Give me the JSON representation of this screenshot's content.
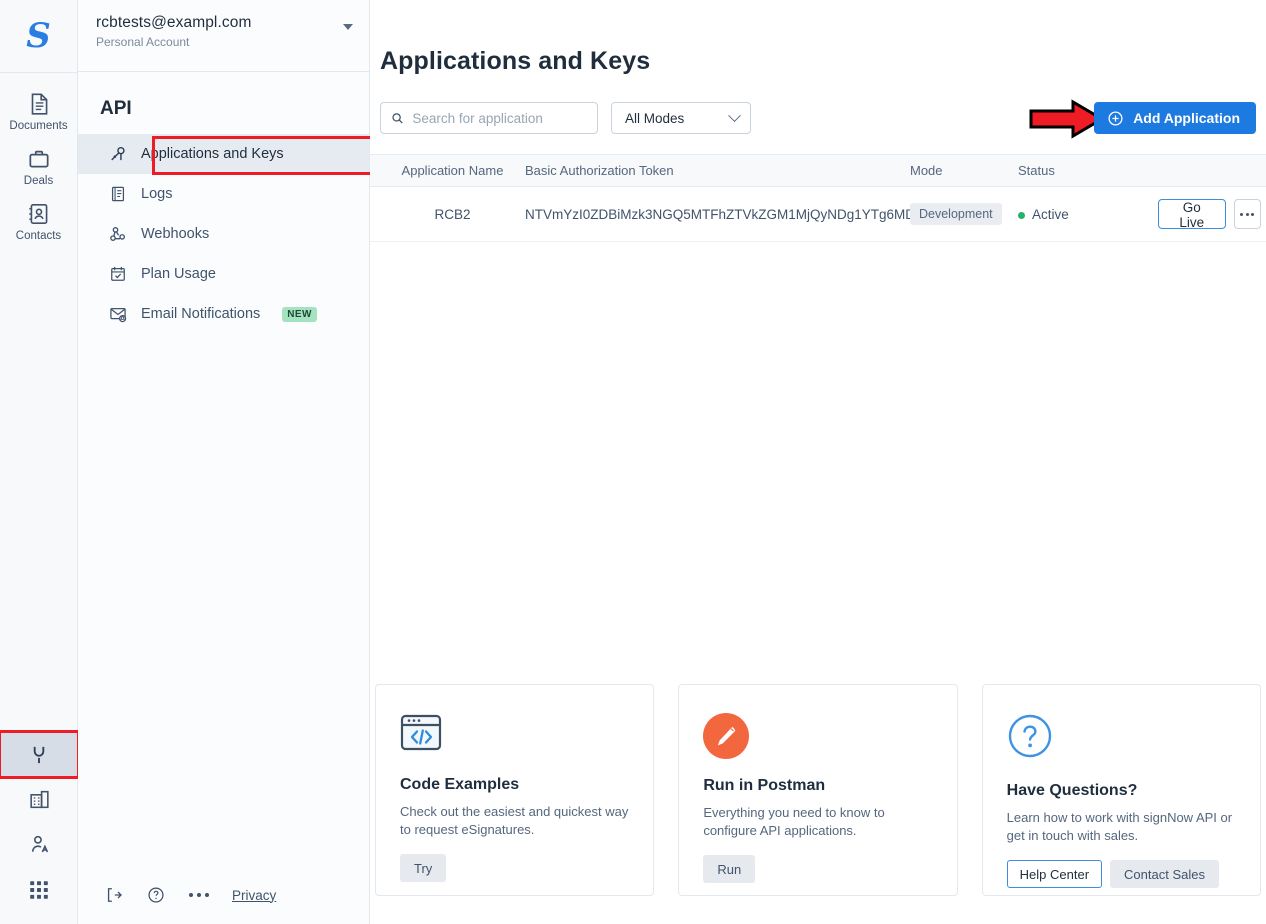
{
  "brand": {
    "logo_glyph": "S",
    "logo_color": "#2a7de1"
  },
  "account": {
    "email": "rcbtests@exampl.com",
    "type": "Personal Account"
  },
  "rail": {
    "items": [
      {
        "label": "Documents",
        "icon": "documents-icon"
      },
      {
        "label": "Deals",
        "icon": "briefcase-icon"
      },
      {
        "label": "Contacts",
        "icon": "contacts-icon"
      }
    ],
    "bottom_items": [
      {
        "icon": "plug-icon",
        "selected": true
      },
      {
        "icon": "building-icon",
        "selected": false
      },
      {
        "icon": "user-admin-icon",
        "selected": false
      },
      {
        "icon": "apps-grid-icon",
        "selected": false
      }
    ]
  },
  "sidebar": {
    "title": "API",
    "items": [
      {
        "label": "Applications and Keys",
        "icon": "key-icon",
        "active": true,
        "badge": ""
      },
      {
        "label": "Logs",
        "icon": "logs-icon",
        "active": false,
        "badge": ""
      },
      {
        "label": "Webhooks",
        "icon": "webhook-icon",
        "active": false,
        "badge": ""
      },
      {
        "label": "Plan Usage",
        "icon": "calendar-check-icon",
        "active": false,
        "badge": ""
      },
      {
        "label": "Email Notifications",
        "icon": "email-bell-icon",
        "active": false,
        "badge": "NEW"
      }
    ],
    "footer": {
      "logout_icon": "logout-icon",
      "help_icon": "help-circle-icon",
      "more_icon": "more-dots-icon",
      "privacy_label": "Privacy"
    }
  },
  "main": {
    "page_title": "Applications and Keys",
    "search": {
      "placeholder": "Search for application",
      "value": "",
      "icon": "search-icon"
    },
    "mode_filter": {
      "selected": "All Modes",
      "icon": "chevron-down-icon"
    },
    "add_button": {
      "label": "Add Application",
      "icon": "plus-circle-icon",
      "color": "#1d7ae0"
    },
    "annotation": {
      "type": "red-arrow",
      "points_to": "Add Application",
      "color": "#ee1c25"
    },
    "table": {
      "columns": [
        "Application Name",
        "Basic Authorization Token",
        "Mode",
        "Status",
        ""
      ],
      "rows": [
        {
          "name": "RCB2",
          "token": "NTVmYzI0ZDBiMzk3NGQ5MTFhZTVkZGM1MjQyNDg1YTg6MD...",
          "mode": "Development",
          "status": "Active",
          "status_color": "#23b26d",
          "action_primary": "Go Live",
          "action_more": "•••"
        }
      ]
    },
    "cards": [
      {
        "icon": "code-window-icon",
        "title": "Code Examples",
        "desc": "Check out the easiest and quickest way to request eSignatures.",
        "buttons": [
          {
            "label": "Try",
            "style": "gray"
          }
        ]
      },
      {
        "icon": "postman-pen-icon",
        "title": "Run in Postman",
        "desc": "Everything you need to know to configure API applications.",
        "buttons": [
          {
            "label": "Run",
            "style": "gray"
          }
        ]
      },
      {
        "icon": "question-circle-icon",
        "title": "Have Questions?",
        "desc": "Learn how to work with signNow API or get in touch with sales.",
        "buttons": [
          {
            "label": "Help Center",
            "style": "blue-outline"
          },
          {
            "label": "Contact Sales",
            "style": "gray"
          }
        ]
      }
    ]
  }
}
